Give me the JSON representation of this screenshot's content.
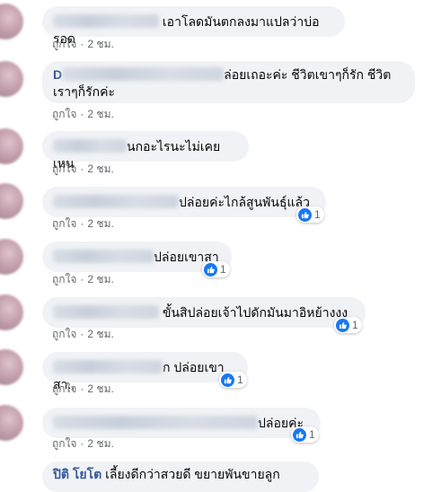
{
  "comments": [
    {
      "text": "เอาโลดมันตกลงมาแปลว่าบ่อรอด",
      "like": "ถูกใจ",
      "time": "2 ชม."
    },
    {
      "name_visible": "D",
      "text_line1": "ล่อยเถอะค่ะ ชีวิตเขาๆก็รัก ชีวิต",
      "text_line2": "เราๆก็รักค่ะ",
      "like": "ถูกใจ",
      "time": "2 ชม."
    },
    {
      "text": "นกอะไรนะไม่เคยเหน",
      "like": "ถูกใจ",
      "time": "2 ชม."
    },
    {
      "text": "ปล่อยค่ะไกล้สูนพันธุ์แล้ว",
      "like": "ถูกใจ",
      "time": "2 ชม.",
      "reactions": "1"
    },
    {
      "text": "ปล่อยเขาสา",
      "like": "ถูกใจ",
      "time": "2 ชม.",
      "reactions": "1"
    },
    {
      "text": "ขั้นสิปล่อยเจ้าไปดักมันมาอิหย้างงง",
      "like": "ถูกใจ",
      "time": "2 ชม.",
      "reactions": "1"
    },
    {
      "text": "ก ปล่อยเขาสา..",
      "like": "ถูกใจ",
      "time": "2 ชม.",
      "reactions": "1"
    },
    {
      "text": "ปล่อยค่ะ",
      "like": "ถูกใจ",
      "time": "2 ชม.",
      "reactions": "1"
    },
    {
      "name": "ปิติ โยโต",
      "text": "เลี้ยงดีกว่าสวยดี ขยายพันขายลูก"
    }
  ],
  "colors": {
    "bubble": "#f0f2f5",
    "like_blue": "#1877f2",
    "meta": "#65676b"
  }
}
